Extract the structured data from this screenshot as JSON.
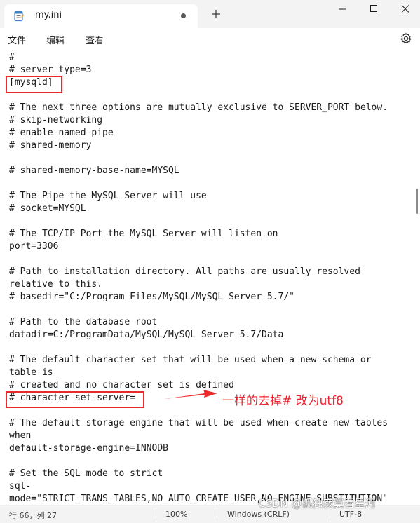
{
  "window": {
    "tab_title": "my.ini",
    "new_tab_symbol": "+"
  },
  "menu": {
    "items": [
      "文件",
      "编辑",
      "查看"
    ],
    "settings_icon": "gear-icon"
  },
  "editor": {
    "lines": [
      "#",
      "# server_type=3",
      "[mysqld]",
      "",
      "# The next three options are mutually exclusive to SERVER_PORT below.",
      "# skip-networking",
      "# enable-named-pipe",
      "# shared-memory",
      "",
      "# shared-memory-base-name=MYSQL",
      "",
      "# The Pipe the MySQL Server will use",
      "# socket=MYSQL",
      "",
      "# The TCP/IP Port the MySQL Server will listen on",
      "port=3306",
      "",
      "# Path to installation directory. All paths are usually resolved",
      "relative to this.",
      "# basedir=\"C:/Program Files/MySQL/MySQL Server 5.7/\"",
      "",
      "# Path to the database root",
      "datadir=C:/ProgramData/MySQL/MySQL Server 5.7/Data",
      "",
      "# The default character set that will be used when a new schema or",
      "table is",
      "# created and no character set is defined",
      "# character-set-server=",
      "",
      "# The default storage engine that will be used when create new tables",
      "when",
      "default-storage-engine=INNODB",
      "",
      "# Set the SQL mode to strict",
      "sql-",
      "mode=\"STRICT_TRANS_TABLES,NO_AUTO_CREATE_USER,NO_ENGINE_SUBSTITUTION\""
    ]
  },
  "annotation": {
    "text": "一样的去掉# 改为utf8",
    "color": "#e8242f"
  },
  "status": {
    "position": "行 66，列 27",
    "zoom": "100%",
    "line_ending": "Windows (CRLF)",
    "encoding": "UTF-8"
  },
  "watermark": "CSDN @孤独寂寞看星河"
}
